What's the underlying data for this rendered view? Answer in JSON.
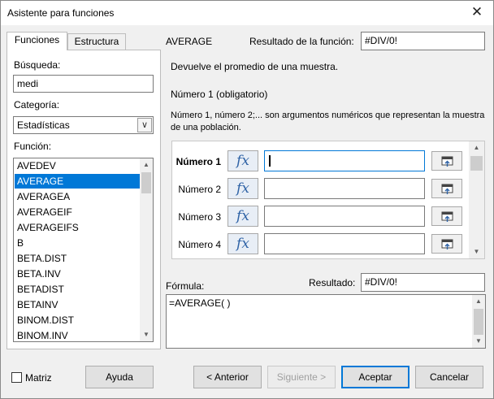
{
  "window": {
    "title": "Asistente para funciones",
    "close_glyph": "✕"
  },
  "tabs": [
    {
      "label": "Funciones",
      "active": true
    },
    {
      "label": "Estructura",
      "active": false
    }
  ],
  "left": {
    "search_label": "Búsqueda:",
    "search_value": "medi",
    "category_label": "Categoría:",
    "category_value": "Estadísticas",
    "function_label": "Función:",
    "functions": [
      "AVEDEV",
      "AVERAGE",
      "AVERAGEA",
      "AVERAGEIF",
      "AVERAGEIFS",
      "B",
      "BETA.DIST",
      "BETA.INV",
      "BETADIST",
      "BETAINV",
      "BINOM.DIST",
      "BINOM.INV"
    ],
    "selected_function": "AVERAGE"
  },
  "right": {
    "function_name": "AVERAGE",
    "result_label": "Resultado de la función:",
    "result_value": "#DIV/0!",
    "description": "Devuelve el promedio de una muestra.",
    "arg_title": "Número 1 (obligatorio)",
    "arg_description": "Número 1, número 2;... son argumentos numéricos que representan la muestra de una población.",
    "args": [
      {
        "label": "Número 1",
        "value": "",
        "bold": true,
        "focused": true
      },
      {
        "label": "Número 2",
        "value": "",
        "bold": false,
        "focused": false
      },
      {
        "label": "Número 3",
        "value": "",
        "bold": false,
        "focused": false
      },
      {
        "label": "Número 4",
        "value": "",
        "bold": false,
        "focused": false
      }
    ],
    "fx_glyph": "fx",
    "formula_label": "Fórmula:",
    "formula_result_label": "Resultado:",
    "formula_result_value": "#DIV/0!",
    "formula_text": "=AVERAGE( )"
  },
  "footer": {
    "matrix_label": "Matriz",
    "matrix_checked": false,
    "help_label": "Ayuda",
    "back_label": "< Anterior",
    "next_label": "Siguiente >",
    "accept_label": "Aceptar",
    "cancel_label": "Cancelar"
  },
  "colors": {
    "accent": "#0078d7",
    "fx": "#2f63a6"
  },
  "icons": {
    "fx": "function-wizard-icon",
    "shrink": "shrink-dialog-icon",
    "close": "close-icon"
  }
}
